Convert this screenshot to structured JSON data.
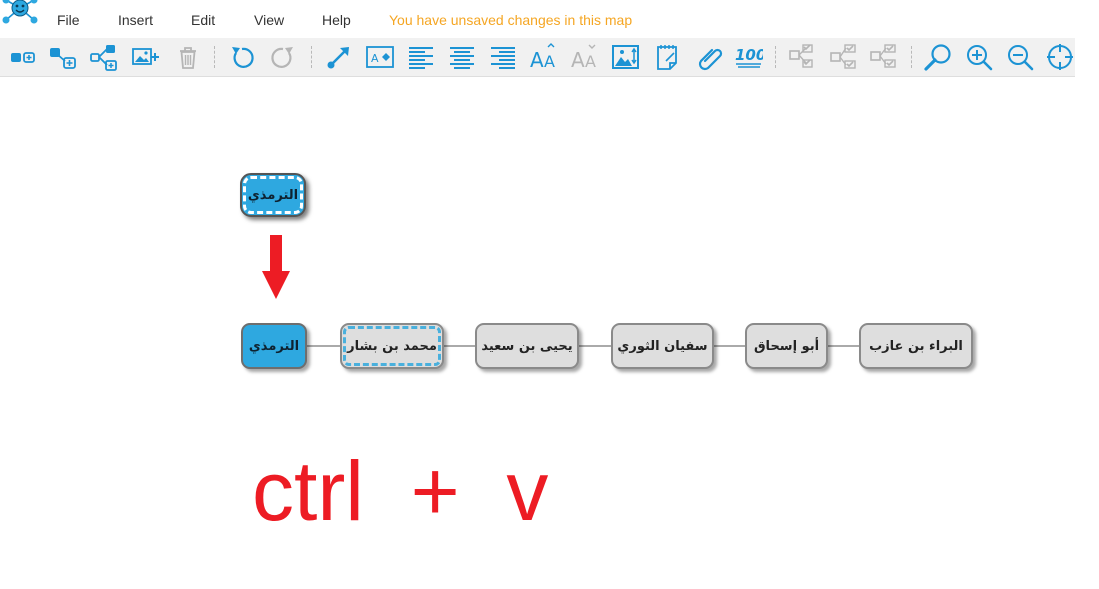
{
  "menu": {
    "items": [
      "File",
      "Insert",
      "Edit",
      "View",
      "Help"
    ],
    "notice": "You have unsaved changes in this map"
  },
  "toolbar": {
    "icons": [
      "add-topic-icon",
      "add-subtopic-icon",
      "add-relationship-icon",
      "add-image-icon",
      "delete-icon",
      "undo-icon",
      "redo-icon",
      "connector-color-icon",
      "topic-style-icon",
      "align-left-icon",
      "align-center-icon",
      "align-right-icon",
      "font-size-icon",
      "font-size-small-icon",
      "topic-image-icon",
      "note-icon",
      "link-icon",
      "score-icon",
      "layout-icon-1",
      "layout-icon-2",
      "layout-icon-3",
      "zoom-fit-icon",
      "zoom-in-icon",
      "zoom-out-icon",
      "center-icon"
    ]
  },
  "map": {
    "floating_node": "الترمذي",
    "chain": [
      "الترمذي",
      "محمد بن بشار",
      "يحيى بن سعيد",
      "سفيان الثوري",
      "أبو إسحاق",
      "البراء بن عازب"
    ]
  },
  "caption": "ctrl  +  v",
  "colors": {
    "accent": "#2ea8e0",
    "icon": "#1c93d4",
    "icon_disabled": "#b5b5b5",
    "notice": "#f5a623",
    "node_fill": "#dedede",
    "shortcut": "#ed1c24",
    "arrow": "#ed1c24"
  }
}
